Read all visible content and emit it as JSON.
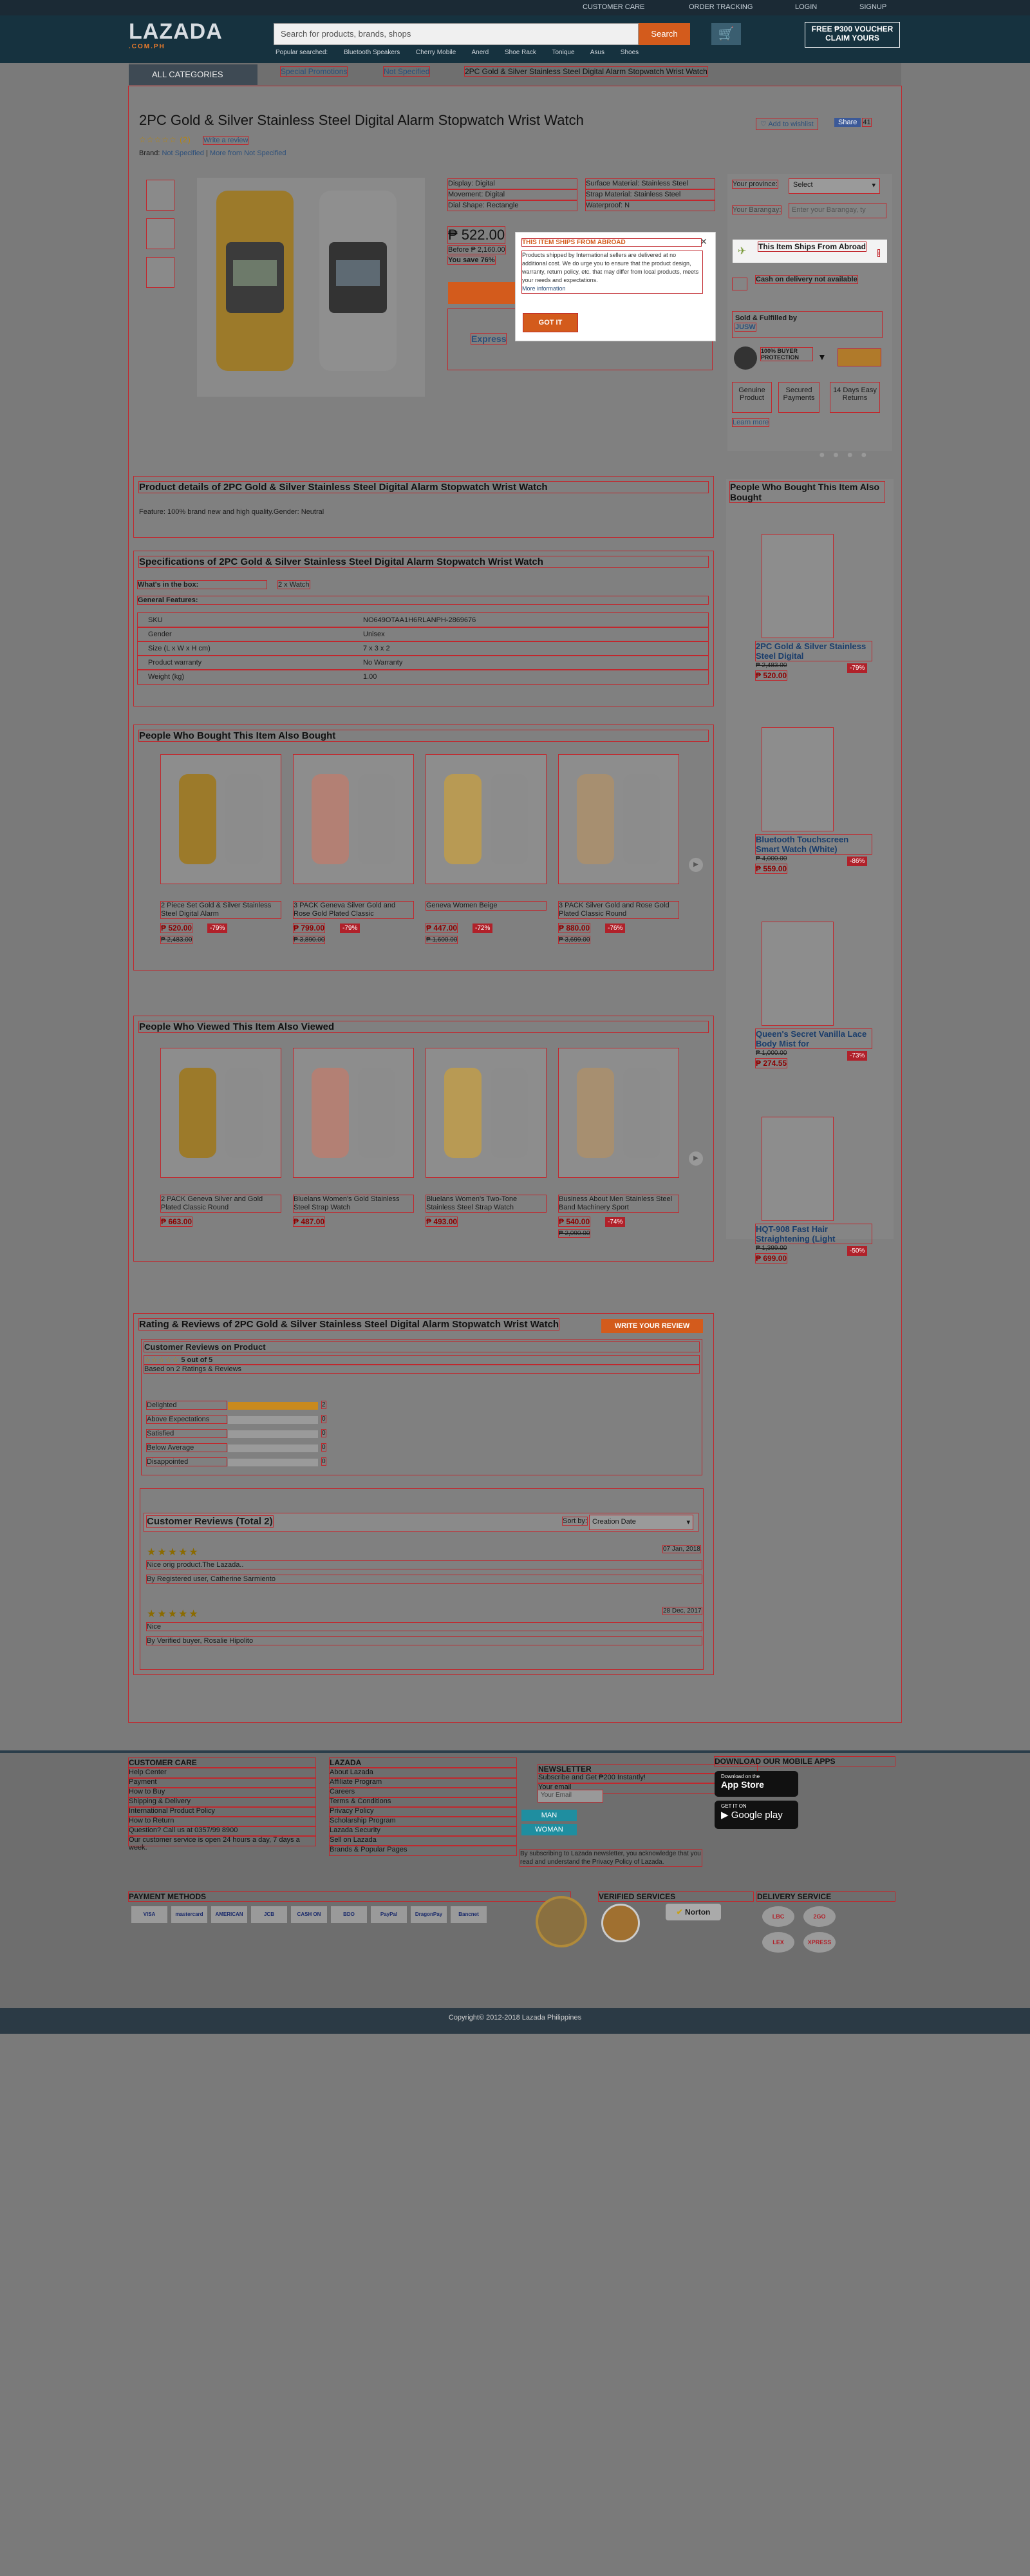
{
  "topbar": {
    "customer_care": "CUSTOMER CARE",
    "order_tracking": "ORDER TRACKING",
    "login": "LOGIN",
    "signup": "SIGNUP"
  },
  "header": {
    "logo": "LAZADA",
    "logo_sub": ".COM.PH",
    "search_placeholder": "Search for products, brands, shops",
    "search_button": "Search",
    "voucher_line1": "FREE ₱300 VOUCHER",
    "voucher_line2": "CLAIM YOURS",
    "popular_label": "Popular searched:",
    "popular": [
      "Bluetooth Speakers",
      "Cherry Mobile",
      "Anerd",
      "Shoe Rack",
      "Tonique",
      "Asus",
      "Shoes"
    ]
  },
  "nav": {
    "all_categories": "ALL CATEGORIES",
    "breadcrumb": [
      "Special Promotions",
      "Not Specified",
      "2PC Gold & Silver Stainless Steel Digital Alarm Stopwatch Wrist Watch"
    ]
  },
  "product": {
    "title": "2PC Gold & Silver Stainless Steel Digital Alarm Stopwatch Wrist Watch",
    "rating_count": "(2)",
    "write_review": "Write a review",
    "brand_label": "Brand:",
    "brand": "Not Specified",
    "brand_more": "More from Not Specified",
    "add_wishlist": "Add to wishlist",
    "share": "Share",
    "share_count": "41",
    "attributes": [
      "Display: Digital",
      "Movement: Digital",
      "Dial Shape: Rectangle",
      "Surface Material: Stainless Steel",
      "Strap Material: Stainless Steel",
      "Waterproof: N"
    ],
    "price": "₱ 522.00",
    "before_price": "Before ₱ 2,160.00",
    "you_save": "You save 76%",
    "add_to_cart": "ADD TO CART",
    "express": "Express"
  },
  "delivery": {
    "province_label": "Your province:",
    "province_value": "Select",
    "barangay_label": "Your Barangay:",
    "barangay_placeholder": "Enter your Barangay, ty",
    "ships_abroad": "This Item Ships From Abroad",
    "cod": "Cash on delivery not available",
    "sold_by": "Sold & Fulfilled by",
    "seller": "JUSW",
    "buyer_protection": "100% BUYER PROTECTION",
    "badges": [
      "Genuine Product",
      "Secured Payments",
      "14 Days Easy Returns"
    ],
    "learn_more": "Learn more"
  },
  "modal": {
    "title": "THIS ITEM SHIPS FROM ABROAD",
    "body": "Products shipped by International sellers are delivered at no additional cost. We do urge you to ensure that the product design, warranty, return policy, etc. that may differ from local products, meets your needs and expectations.",
    "link": "More information",
    "button": "GOT IT"
  },
  "details": {
    "title": "Product details of 2PC Gold & Silver Stainless Steel Digital Alarm Stopwatch Wrist Watch",
    "feature": "Feature: 100% brand new and high quality.Gender: Neutral"
  },
  "specs": {
    "title": "Specifications of 2PC Gold & Silver Stainless Steel Digital Alarm Stopwatch Wrist Watch",
    "in_box_label": "What's in the box:",
    "in_box_value": "2 x Watch",
    "general": "General Features:",
    "rows": [
      {
        "k": "SKU",
        "v": "NO649OTAA1H6RLANPH-2869676"
      },
      {
        "k": "Gender",
        "v": "Unisex"
      },
      {
        "k": "Size (L x W x H cm)",
        "v": "7 x 3 x 2"
      },
      {
        "k": "Product warranty",
        "v": "No Warranty"
      },
      {
        "k": "Weight (kg)",
        "v": "1.00"
      }
    ]
  },
  "also_bought": {
    "title": "People Who Bought This Item Also Bought",
    "items": [
      {
        "name": "2 Piece Set Gold & Silver Stainless Steel Digital Alarm",
        "price": "₱ 520.00",
        "disc": "-79%",
        "old": "₱ 2,483.00"
      },
      {
        "name": "3 PACK Geneva Silver Gold and Rose Gold Plated Classic",
        "price": "₱ 799.00",
        "disc": "-79%",
        "old": "₱ 3,890.00"
      },
      {
        "name": "Geneva Women Beige",
        "price": "₱ 447.00",
        "disc": "-72%",
        "old": "₱ 1,600.00"
      },
      {
        "name": "3 PACK Silver Gold and Rose Gold Plated Classic Round",
        "price": "₱ 880.00",
        "disc": "-76%",
        "old": "₱ 3,699.00"
      }
    ]
  },
  "also_viewed": {
    "title": "People Who Viewed This Item Also Viewed",
    "items": [
      {
        "name": "2 PACK Geneva Silver and Gold Plated Classic Round",
        "price": "₱ 663.00",
        "disc": "",
        "old": ""
      },
      {
        "name": "Bluelans Women's Gold Stainless Steel Strap Watch",
        "price": "₱ 487.00",
        "disc": "",
        "old": ""
      },
      {
        "name": "Bluelans Women's Two-Tone Stainless Steel Strap Watch",
        "price": "₱ 493.00",
        "disc": "",
        "old": ""
      },
      {
        "name": "Business About Men Stainless Steel Band Machinery Sport",
        "price": "₱ 540.00",
        "disc": "-74%",
        "old": "₱ 2,090.00"
      }
    ]
  },
  "side": {
    "title": "People Who Bought This Item Also Bought",
    "items": [
      {
        "name": "2PC Gold & Silver Stainless Steel Digital",
        "price": "₱ 520.00",
        "disc": "-79%",
        "old": "₱ 2,483.00"
      },
      {
        "name": "Bluetooth Touchscreen Smart Watch (White)",
        "price": "₱ 559.00",
        "disc": "-86%",
        "old": "₱ 4,000.00"
      },
      {
        "name": "Queen's Secret Vanilla Lace Body Mist for",
        "price": "₱ 274.55",
        "disc": "-73%",
        "old": "₱ 1,000.00"
      },
      {
        "name": "HQT-908 Fast Hair Straightening (Light",
        "price": "₱ 699.00",
        "disc": "-50%",
        "old": "₱ 1,399.00"
      }
    ]
  },
  "reviews": {
    "title": "Rating & Reviews of 2PC Gold & Silver Stainless Steel Digital Alarm Stopwatch Wrist Watch",
    "write_button": "WRITE YOUR REVIEW",
    "customer_reviews": "Customer Reviews on Product",
    "score": "5 out of 5",
    "based_on": "Based on 2 Ratings & Reviews",
    "breakdown": [
      {
        "label": "Delighted",
        "count": "2",
        "fraction": 1.0
      },
      {
        "label": "Above Expectations",
        "count": "0",
        "fraction": 0
      },
      {
        "label": "Satisfied",
        "count": "0",
        "fraction": 0
      },
      {
        "label": "Below Average",
        "count": "0",
        "fraction": 0
      },
      {
        "label": "Disappointed",
        "count": "0",
        "fraction": 0
      }
    ],
    "list_title": "Customer Reviews (Total 2)",
    "sort_label": "Sort by:",
    "sort_value": "Creation Date",
    "entries": [
      {
        "date": "07 Jan, 2018",
        "text": "Nice orig product.The Lazada..",
        "by": "By Registered user, Catherine Sarmiento"
      },
      {
        "date": "28 Dec, 2017",
        "text": "Nice",
        "by": "By Verified buyer, Rosalie Hipolito"
      }
    ]
  },
  "footer": {
    "customer_care": {
      "title": "CUSTOMER CARE",
      "links": [
        "Help Center",
        "Payment",
        "How to Buy",
        "Shipping & Delivery",
        "International Product Policy",
        "How to Return",
        "Question? Call us at 0357/99 8900",
        "Our customer service is open 24 hours a day, 7 days a week."
      ]
    },
    "lazada": {
      "title": "LAZADA",
      "links": [
        "About Lazada",
        "Affiliate Program",
        "Careers",
        "Terms & Conditions",
        "Privacy Policy",
        "Scholarship Program",
        "Lazada Security",
        "Sell on Lazada",
        "Brands & Popular Pages"
      ]
    },
    "newsletter": {
      "title": "NEWSLETTER",
      "subtitle": "Subscribe and Get ₱200 Instantly!",
      "email_label": "Your email",
      "email_placeholder": "Your Email",
      "man": "MAN",
      "woman": "WOMAN",
      "note": "By subscribing to Lazada newsletter, you acknowledge that you read and understand the Privacy Policy of Lazada."
    },
    "apps": {
      "title": "DOWNLOAD OUR MOBILE APPS",
      "appstore": "App Store",
      "appstore_small": "Download on the",
      "googleplay": "Google play",
      "googleplay_small": "GET IT ON"
    },
    "payment": {
      "title": "PAYMENT METHODS",
      "items": [
        "VISA",
        "mastercard",
        "AMERICAN EXPRESS",
        "JCB",
        "CASH ON DELIVERY",
        "BDO",
        "PayPal",
        "DragonPay",
        "Bancnet"
      ]
    },
    "verified": {
      "title": "VERIFIED SERVICES",
      "norton": "Norton"
    },
    "delivery": {
      "title": "DELIVERY SERVICE",
      "items": [
        "LBC",
        "2GO",
        "LEX",
        "XPRESS"
      ]
    },
    "copyright": "Copyright© 2012-2018 Lazada Philippines"
  },
  "colors": {
    "accent": "#d35b1c",
    "link": "#2c4f7a",
    "outline": "#c1272d",
    "star": "#b8860b"
  }
}
